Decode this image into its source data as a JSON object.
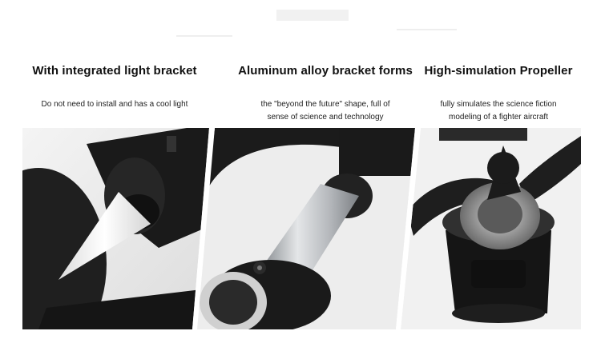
{
  "features": [
    {
      "title": "With integrated light bracket",
      "lines": [
        "Do not need to install and has a cool light"
      ]
    },
    {
      "title": "Aluminum alloy bracket forms",
      "lines": [
        "the \"beyond the future\" shape, full of",
        "sense of science and technology"
      ]
    },
    {
      "title": "High-simulation Propeller",
      "lines": [
        "fully simulates the science fiction",
        "modeling of a fighter aircraft"
      ]
    }
  ],
  "colors": {
    "background": "#ffffff",
    "dark_plastic": "#1c1c1c",
    "light_cone": "#f4f4f4",
    "aluminum": "#b9bcc0",
    "photo_bg": "#e9e9e9"
  }
}
